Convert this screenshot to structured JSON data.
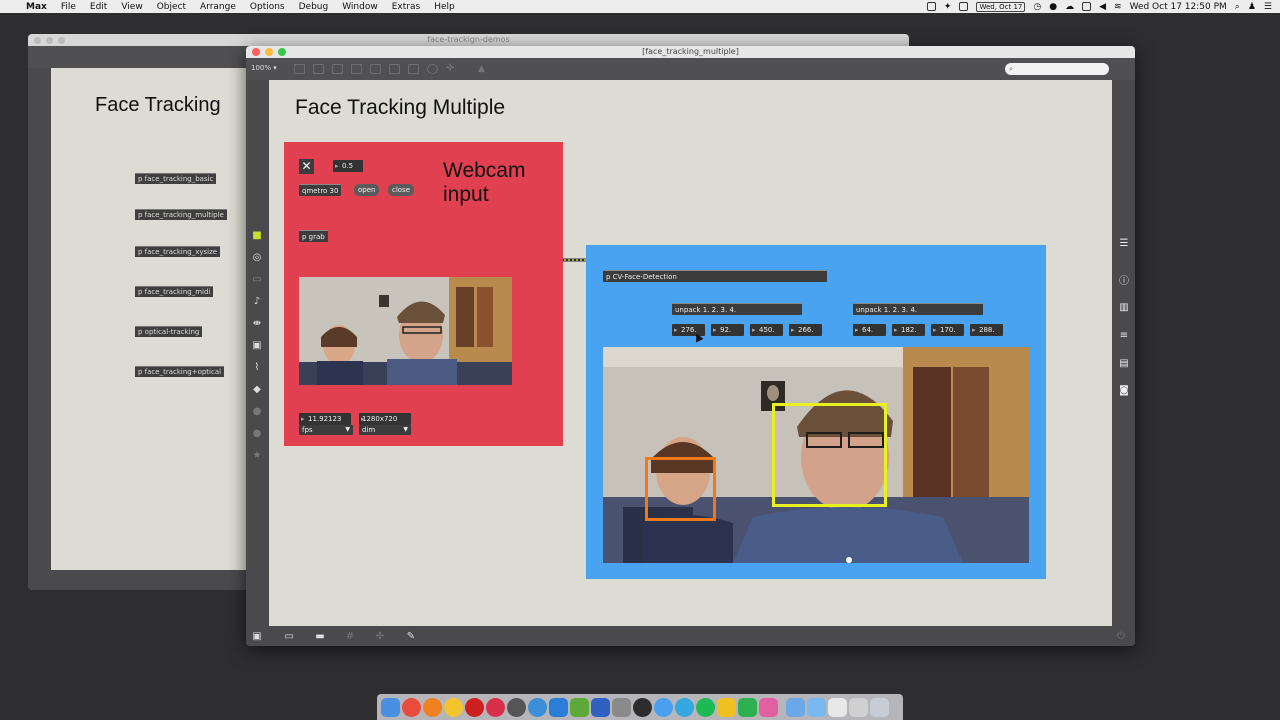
{
  "menubar": {
    "app": "Max",
    "menus": [
      "File",
      "Edit",
      "View",
      "Object",
      "Arrange",
      "Options",
      "Debug",
      "Window",
      "Extras",
      "Help"
    ],
    "date_badge": "Wed, Oct 17",
    "clock": "Wed Oct 17  12:50 PM"
  },
  "background_window": {
    "title": "face-trackign-demos",
    "patch_title": "Face Tracking",
    "objects": [
      "p face_tracking_basic",
      "p face_tracking_multiple",
      "p face_tracking_xysize",
      "p face_tracking_midi",
      "p optical-tracking",
      "p face_tracking+optical"
    ]
  },
  "main_window": {
    "title": "[face_tracking_multiple]",
    "zoom": "100% ▾",
    "patch_title": "Face Tracking Multiple"
  },
  "webcam_panel": {
    "label_line1": "Webcam",
    "label_line2": "input",
    "toggle_glyph": "✕",
    "number_box": "0.5",
    "qmetro": "qmetro 30",
    "open_msg": "open",
    "close_msg": "close",
    "grab_obj": "p grab",
    "fps_value": "11.92123",
    "dim_value": "1280x720",
    "fps_menu": "fps",
    "dim_menu": "dim"
  },
  "detection_panel": {
    "detector_obj": "p CV-Face-Detection",
    "unpack_left": "unpack 1. 2. 3. 4.",
    "unpack_right": "unpack 1. 2. 3. 4.",
    "face1_values": [
      "276.",
      "92.",
      "450.",
      "266."
    ],
    "face2_values": [
      "64.",
      "182.",
      "170.",
      "288."
    ]
  },
  "colors": {
    "red_panel": "#e04050",
    "blue_panel": "#4aa3f0",
    "face_box_yellow": "#e8f020",
    "face_box_orange": "#f07818",
    "canvas": "#dcdcd4"
  }
}
